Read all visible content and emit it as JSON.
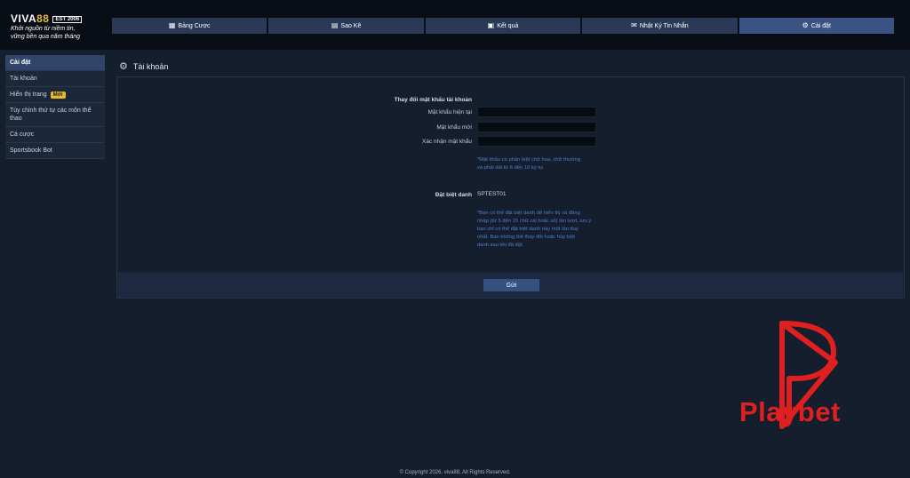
{
  "header": {
    "logo_main": "VIVA",
    "logo_accent": "88",
    "logo_badge": "EST 2006",
    "tagline_1": "Khởi nguồn từ niềm tin,",
    "tagline_2": "vững bền qua năm tháng"
  },
  "nav": [
    {
      "label": "Bảng Cược",
      "icon": "table-icon"
    },
    {
      "label": "Sao Kê",
      "icon": "document-icon"
    },
    {
      "label": "Kết quả",
      "icon": "results-icon"
    },
    {
      "label": "Nhật Ký Tin Nhắn",
      "icon": "mail-icon"
    },
    {
      "label": "Cài đặt",
      "icon": "gear-icon",
      "active": true
    }
  ],
  "sidebar": {
    "head": "Cài đặt",
    "items": [
      {
        "label": "Tài khoản"
      },
      {
        "label": "Hiển thị trang",
        "badge": "Mới"
      },
      {
        "label": "Tùy chỉnh thứ tự các môn thể thao"
      },
      {
        "label": "Cá cược"
      },
      {
        "label": "Sportsbook Bot"
      }
    ]
  },
  "panel": {
    "title": "Tài khoản",
    "password_heading": "Thay đổi mật khẩu tài khoản",
    "current_password_label": "Mật khẩu hiện tại",
    "new_password_label": "Mật khẩu mới",
    "confirm_password_label": "Xác nhận mật khẩu",
    "password_note_1": "*Mật khẩu có phân biệt chữ hoa, chữ thường",
    "password_note_2": "và phải dài từ 6 đến 10 ký tự.",
    "nickname_label": "Đặt biệt danh",
    "nickname_value": "SPTEST01",
    "nickname_note": [
      "*Bạn có thể đặt biệt danh để hiển thị và đăng",
      "nhập (từ 5 đến 15 chữ cái hoặc số) lần lượt, lưu ý",
      "bạn chỉ có thể đặt biệt danh này một lần duy",
      "nhất. Bạn không thể thay đổi hoặc hủy biệt",
      "danh sau khi đã đặt."
    ],
    "submit_label": "Gửi"
  },
  "brand": {
    "name": "Playbet",
    "color": "#e02020"
  },
  "footer": "© Copyright 2026. viva88. All Rights Reserved."
}
